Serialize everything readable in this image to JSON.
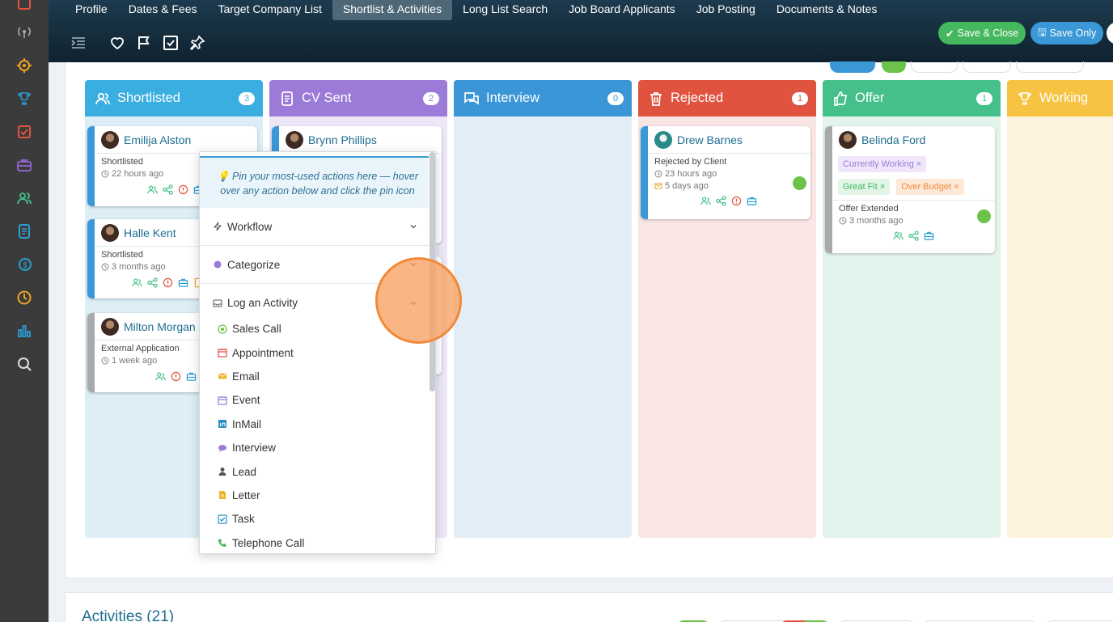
{
  "header": {
    "tabs": [
      "Profile",
      "Dates & Fees",
      "Target Company List",
      "Shortlist & Activities",
      "Long List Search",
      "Job Board Applicants",
      "Job Posting",
      "Documents & Notes"
    ],
    "active_tab": "Shortlist & Activities",
    "save_close_label": "Save & Close",
    "save_only_label": "Save Only"
  },
  "rail": {
    "icons": [
      "inbox-icon",
      "broadcast-icon",
      "target-icon",
      "trophy-icon",
      "checkbox-icon",
      "briefcase-icon",
      "users-icon",
      "document-icon",
      "coins-icon",
      "clock-icon",
      "bar-chart-icon",
      "search-icon"
    ]
  },
  "columns": [
    {
      "title": "Shortlisted",
      "count": "3",
      "color": "#3aaee0",
      "bg": "#ddeef7"
    },
    {
      "title": "CV Sent",
      "count": "2",
      "color": "#9b7ad8",
      "bg": "#ece6f7"
    },
    {
      "title": "Interview",
      "count": "0",
      "color": "#3a96d6",
      "bg": "#e2edf6"
    },
    {
      "title": "Rejected",
      "count": "1",
      "color": "#e0533f",
      "bg": "#f9e6e4"
    },
    {
      "title": "Offer",
      "count": "1",
      "color": "#45c08a",
      "bg": "#e3f4ec"
    },
    {
      "title": "Working",
      "count": "",
      "color": "#f6c342",
      "bg": "#fdf3dd"
    }
  ],
  "cards": {
    "emilija": {
      "name": "Emilija Alston",
      "status": "Shortlisted",
      "time": "22 hours ago"
    },
    "halle": {
      "name": "Halle Kent",
      "status": "Shortlisted",
      "time": "3 months ago"
    },
    "milton": {
      "name": "Milton Morgan",
      "status": "External Application",
      "time": "1 week ago"
    },
    "brynn": {
      "name": "Brynn Phillips"
    },
    "drew": {
      "name": "Drew Barnes",
      "status": "Rejected by Client",
      "time": "23 hours ago",
      "time2": "5 days ago"
    },
    "belinda": {
      "name": "Belinda Ford",
      "tags": [
        "Currently Working",
        "Great Fit",
        "Over Budget"
      ],
      "status": "Offer Extended",
      "time": "3 months ago"
    }
  },
  "menu": {
    "tip": "Pin your most-used actions here — hover over any action below and click the pin icon",
    "sections": [
      "Workflow",
      "Categorize",
      "Log an Activity"
    ],
    "items": [
      {
        "label": "Sales Call",
        "icon": "sales-call-icon",
        "color": "#6cc24a"
      },
      {
        "label": "Appointment",
        "icon": "calendar-icon",
        "color": "#e0533f"
      },
      {
        "label": "Email",
        "icon": "envelope-icon",
        "color": "#f0b429"
      },
      {
        "label": "Event",
        "icon": "event-calendar-icon",
        "color": "#9b7ad8"
      },
      {
        "label": "InMail",
        "icon": "linkedin-icon",
        "color": "#2a8fc7"
      },
      {
        "label": "Interview",
        "icon": "chat-icon",
        "color": "#9b7ad8"
      },
      {
        "label": "Lead",
        "icon": "person-icon",
        "color": "#555555"
      },
      {
        "label": "Letter",
        "icon": "letter-icon",
        "color": "#f0b429"
      },
      {
        "label": "Task",
        "icon": "task-check-icon",
        "color": "#2a8fc7"
      },
      {
        "label": "Telephone Call",
        "icon": "phone-icon",
        "color": "#45b85f"
      }
    ]
  },
  "activities": {
    "title": "Activities (21)"
  }
}
